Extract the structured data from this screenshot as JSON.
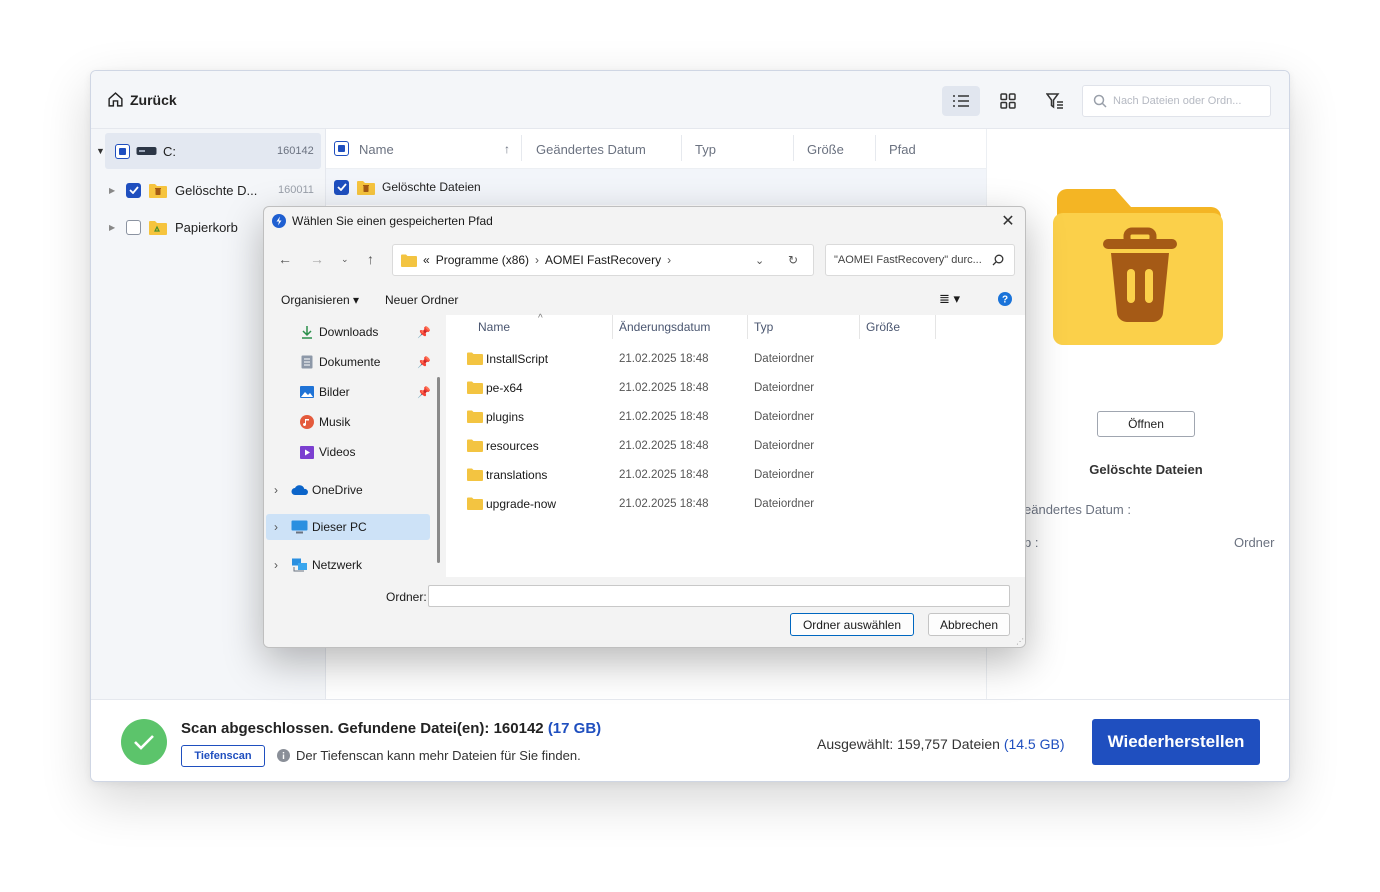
{
  "app": {
    "back_label": "Zurück",
    "search_placeholder": "Nach Dateien oder Ordn...",
    "tree": [
      {
        "label": "C:",
        "count": "160142"
      },
      {
        "label": "Gelöschte D...",
        "count": "160011"
      },
      {
        "label": "Papierkorb",
        "count": ""
      }
    ],
    "columns": {
      "name": "Name",
      "modified": "Geändertes Datum",
      "type": "Typ",
      "size": "Größe",
      "path": "Pfad"
    },
    "rows": [
      {
        "name": "Gelöschte Dateien"
      }
    ],
    "details": {
      "open_label": "Öffnen",
      "title": "Gelöschte Dateien",
      "modified_label": "eändertes Datum :",
      "type_label": "p :",
      "type_value": "Ordner"
    },
    "bottom": {
      "scan_text": "Scan abgeschlossen. Gefundene Datei(en): 160142",
      "scan_size": "(17 GB)",
      "deep_scan_label": "Tiefenscan",
      "deep_scan_info": "Der Tiefenscan kann mehr Dateien für Sie finden.",
      "selected_text": "Ausgewählt: 159,757 Dateien",
      "selected_size": "(14.5 GB)",
      "restore_label": "Wiederherstellen"
    }
  },
  "dialog": {
    "title": "Wählen Sie einen gespeicherten Pfad",
    "address": {
      "chevrons": "«",
      "seg1": "Programme (x86)",
      "seg2": "AOMEI FastRecovery"
    },
    "search_placeholder": "\"AOMEI FastRecovery\" durc...",
    "organize_label": "Organisieren ▾",
    "new_folder_label": "Neuer Ordner",
    "nav": [
      {
        "label": "Downloads",
        "icon": "download-icon"
      },
      {
        "label": "Dokumente",
        "icon": "document-icon"
      },
      {
        "label": "Bilder",
        "icon": "pictures-icon"
      },
      {
        "label": "Musik",
        "icon": "music-icon"
      },
      {
        "label": "Videos",
        "icon": "videos-icon"
      },
      {
        "label": "OneDrive",
        "icon": "cloud-icon"
      },
      {
        "label": "Dieser PC",
        "icon": "pc-icon"
      },
      {
        "label": "Netzwerk",
        "icon": "network-icon"
      }
    ],
    "columns": {
      "name": "Name",
      "date": "Änderungsdatum",
      "type": "Typ",
      "size": "Größe"
    },
    "rows": [
      {
        "name": "InstallScript",
        "date": "21.02.2025 18:48",
        "type": "Dateiordner"
      },
      {
        "name": "pe-x64",
        "date": "21.02.2025 18:48",
        "type": "Dateiordner"
      },
      {
        "name": "plugins",
        "date": "21.02.2025 18:48",
        "type": "Dateiordner"
      },
      {
        "name": "resources",
        "date": "21.02.2025 18:48",
        "type": "Dateiordner"
      },
      {
        "name": "translations",
        "date": "21.02.2025 18:48",
        "type": "Dateiordner"
      },
      {
        "name": "upgrade-now",
        "date": "21.02.2025 18:48",
        "type": "Dateiordner"
      }
    ],
    "folder_label": "Ordner:",
    "select_label": "Ordner auswählen",
    "cancel_label": "Abbrechen"
  }
}
